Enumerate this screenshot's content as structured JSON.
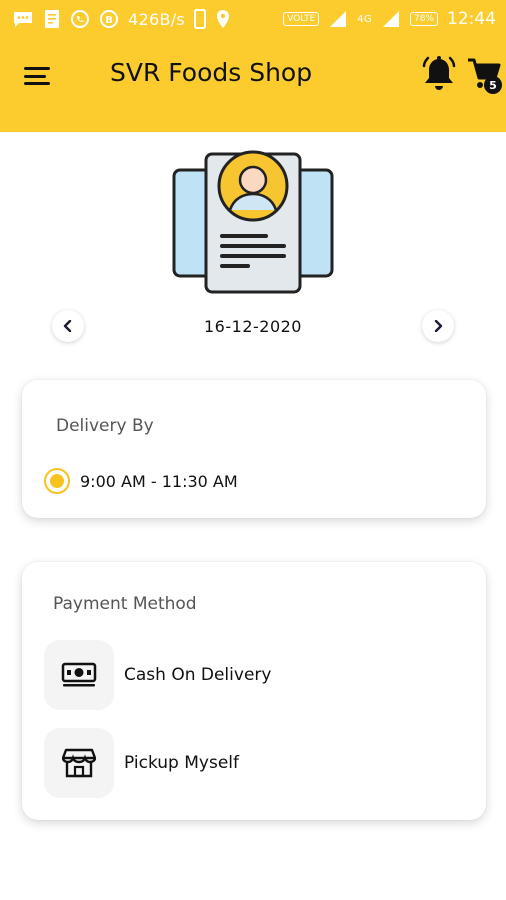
{
  "status_bar": {
    "net_speed": "426B/s",
    "volte": "VOLTE",
    "network": "4G",
    "battery": "78%",
    "time": "12:44"
  },
  "app_bar": {
    "title": "SVR Foods Shop",
    "cart_count": "5"
  },
  "date_selector": {
    "date": "16-12-2020"
  },
  "delivery": {
    "title": "Delivery By",
    "slot": "9:00 AM - 11:30 AM"
  },
  "payment": {
    "title": "Payment Method",
    "options": [
      {
        "label": "Cash On Delivery",
        "icon": "cash-icon"
      },
      {
        "label": "Pickup Myself",
        "icon": "store-icon"
      }
    ]
  },
  "colors": {
    "accent": "#fccc2f",
    "radio": "#f8c31f"
  }
}
